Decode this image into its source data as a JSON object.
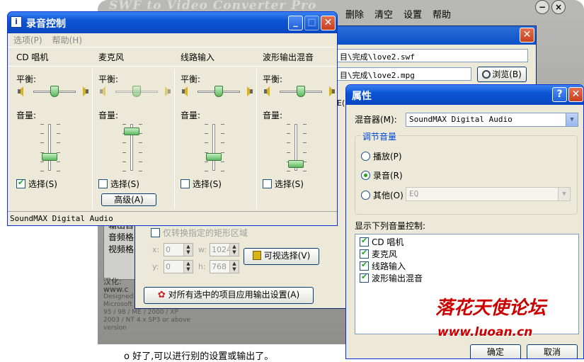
{
  "swf_app": {
    "title": "SWF to Video Converter Pro",
    "menu": [
      "删除",
      "清空",
      "设置",
      "帮助"
    ],
    "side_lines": [
      "输出目",
      "音频格",
      "视频格"
    ],
    "footer": [
      "汉化:",
      "www.c",
      "Designed",
      "Microsoft Windows",
      "95 / 98 / ME / 2000 / XP",
      "2003 / NT 4.x SP3 or above version"
    ]
  },
  "convert_dialog": {
    "source_path": "目\\完成\\love2.swf",
    "output_path": "目\\完成\\love2.mpg",
    "browse_label": "浏览(B)",
    "side_label": "E(",
    "only_region_label": "仅转换指定的矩形区域",
    "x_label": "x:",
    "x_value": "0",
    "y_label": "y:",
    "y_value": "0",
    "w_label": "w:",
    "w_value": "1024",
    "h_label": "h:",
    "h_value": "768",
    "visual_select_label": "可视选择(V)",
    "apply_label": "对所有选中的项目应用输出设置(A)"
  },
  "recording_control": {
    "title": "录音控制",
    "menu": [
      "选项(P)",
      "帮助(H)"
    ],
    "balance_label": "平衡:",
    "volume_label": "音量:",
    "select_label": "选择(S)",
    "advanced_label": "高级(A)",
    "status": "SoundMAX Digital Audio",
    "channels": [
      {
        "name": "CD 唱机",
        "balance": 0.5,
        "volume": 0.3,
        "selected": true,
        "balance_active": true
      },
      {
        "name": "麦克风",
        "balance": 0.5,
        "volume": 0.85,
        "selected": false,
        "balance_active": false
      },
      {
        "name": "线路输入",
        "balance": 0.5,
        "volume": 0.3,
        "selected": false,
        "balance_active": true
      },
      {
        "name": "波形输出混音",
        "balance": 0.5,
        "volume": 0.15,
        "selected": false,
        "balance_active": true
      }
    ]
  },
  "properties": {
    "title": "属性",
    "mixer_label": "混音器(M):",
    "mixer_value": "SoundMAX Digital Audio",
    "adjust_group": "调节音量",
    "radio_playback": "播放(P)",
    "radio_record": "录音(R)",
    "radio_other": "其他(O)",
    "other_value": "EQ",
    "selected_radio": "record",
    "show_label": "显示下列音量控制:",
    "controls": [
      {
        "label": "CD 唱机",
        "checked": true
      },
      {
        "label": "麦克风",
        "checked": true
      },
      {
        "label": "线路输入",
        "checked": true
      },
      {
        "label": "波形输出混音",
        "checked": true
      }
    ],
    "ok_label": "确定",
    "cancel_label": "取消"
  },
  "watermark": {
    "text": "落花天使论坛",
    "url": "www.luoan.cn"
  },
  "bottom_text": "ο 好了,可以进行别的设置或输出了。"
}
